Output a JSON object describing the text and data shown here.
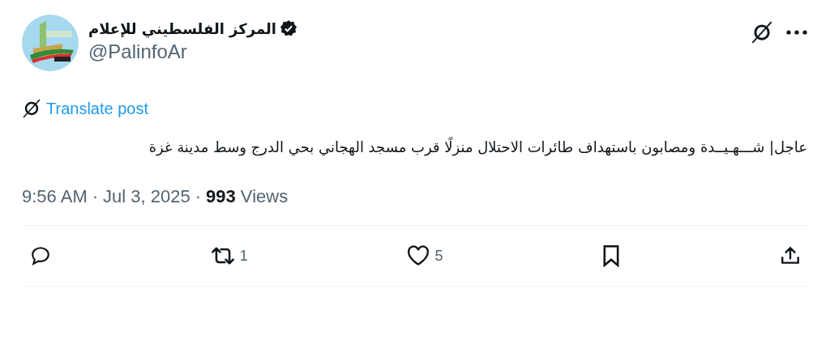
{
  "post": {
    "author": {
      "name": "المركز الفلسطيني للإعلام",
      "handle": "@PalinfoAr",
      "verified": true
    },
    "translate": "Translate post",
    "text": "عاجل| شـــهـيــدة ومصابون باستهداف طائرات الاحتلال منزلًا قرب مسجد الهجاني بحي الدرج وسط مدينة غزة",
    "meta": [
      {
        "kind": "time",
        "text": "9:56 AM"
      },
      {
        "kind": "sep",
        "text": "·"
      },
      {
        "kind": "date",
        "text": "Jul 3, 2025"
      },
      {
        "kind": "sep",
        "text": "·"
      },
      {
        "kind": "views",
        "count": "993",
        "label": "Views"
      }
    ],
    "actions": [
      {
        "kind": "reply"
      },
      {
        "kind": "repost",
        "count": "1"
      },
      {
        "kind": "like",
        "count": "5"
      },
      {
        "kind": "bookmark"
      },
      {
        "kind": "share"
      }
    ]
  }
}
